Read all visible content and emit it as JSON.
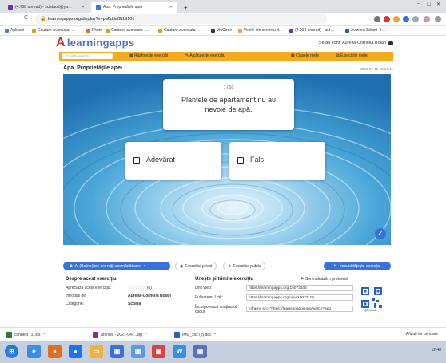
{
  "browser": {
    "tabs": [
      {
        "label": "(4.738 unread) - scistaud@ya…",
        "active": false,
        "color": "#6b2fb3"
      },
      {
        "label": "Apa. Proprietăţile apei",
        "active": true,
        "color": "#3b72d9"
      }
    ],
    "new_tab": "+",
    "url": "learningapps.org/display?v=pa6ddaf2t19101",
    "bookmarks": [
      {
        "label": "Aplicații",
        "color": "#4a7bd5"
      },
      {
        "label": "Cautare avansata -…",
        "color": "#d4a017"
      },
      {
        "label": "Photo",
        "color": "#e07020"
      },
      {
        "label": "Cautare avansata -…",
        "color": "#d4a017"
      },
      {
        "label": "Cautare avansata -…",
        "color": "#d4a017"
      },
      {
        "label": "VinCode",
        "color": "#333333"
      },
      {
        "label": "Vezile din serviciu d…",
        "color": "#e8a33b"
      },
      {
        "label": "(2.204 unread) - aur…",
        "color": "#6b2fb3"
      },
      {
        "label": "Aviziera Sitiani - I…",
        "color": "#2f5bb3"
      }
    ]
  },
  "site": {
    "logo": "learningapps",
    "user": "Setări cont: Aurelia-Cornelia Bolan",
    "search_placeholder": "Caută exerciţii",
    "nav": [
      "Răsfoiește exerciţii",
      "Alcătuiește exerciţiu",
      "Clasele mele",
      "Exerciţiile mele"
    ]
  },
  "page": {
    "title": "Apa. Proprietăţile apei",
    "date": "2021-07-12 10:14:41"
  },
  "quiz": {
    "counter": "1 / 10",
    "question": "Plantele de apartament nu au nevoie de apă.",
    "answers": [
      "Adevărat",
      "Fals"
    ]
  },
  "actions": {
    "similar": "Ai (Ba)ne(i)ce exerciţii asemănătoare",
    "private": "Exerciţiul privat",
    "public": "Exerciţiul public",
    "improve": "Îmbunătăţeşte exerciţiu"
  },
  "about": {
    "heading": "Despre acest exerciţiu",
    "rows": [
      {
        "label": "Apreciază acest exerciţiu:",
        "value": "(0)"
      },
      {
        "label": "Introdus de:",
        "value": "Aurelia-Cornelia Bolan"
      },
      {
        "label": "Categorie:",
        "value": "Școala"
      }
    ]
  },
  "share": {
    "heading": "Unește şi trimite exerciţiu",
    "report": "Semnalează o problemă",
    "rows": [
      {
        "label": "Link web:",
        "value": "https://learningapps.org/15073105"
      },
      {
        "label": "Fullscreen Link:",
        "value": "https://learningapps.org/view15073105"
      },
      {
        "label": "Încorporează conţinutul codul:",
        "value": "<iframe src=\"https://learningapps.org/watch?app"
      }
    ],
    "scorm": "SCORM   Blocks Button",
    "qr_label": "QR-Code"
  },
  "downloads": {
    "items": [
      "connect (1).xls",
      "archive - 2021-04-…zip",
      "IMG_xxx (2).doc"
    ],
    "show_all": "Afișați tot pe toate"
  },
  "taskbar": {
    "clock": "12:48"
  }
}
